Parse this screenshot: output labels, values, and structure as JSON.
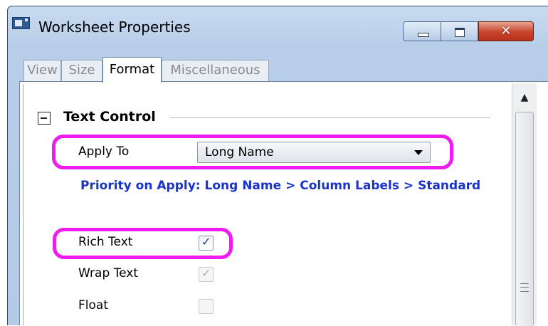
{
  "window": {
    "title": "Worksheet Properties",
    "controls": {
      "minimize_icon": "minimize-icon",
      "maximize_icon": "maximize-icon",
      "close_glyph": "✕"
    }
  },
  "tabs": [
    {
      "label": "View",
      "active": false
    },
    {
      "label": "Size",
      "active": false
    },
    {
      "label": "Format",
      "active": true
    },
    {
      "label": "Miscellaneous",
      "active": false
    }
  ],
  "section": {
    "toggle_icon": "collapse-minus-icon",
    "title": "Text Control"
  },
  "apply_to": {
    "label": "Apply To",
    "value": "Long Name"
  },
  "priority_note": "Priority on Apply: Long Name > Column Labels > Standard",
  "checkboxes": [
    {
      "label": "Rich Text",
      "checked": true,
      "enabled": true
    },
    {
      "label": "Wrap Text",
      "checked": true,
      "enabled": false
    },
    {
      "label": "Float",
      "checked": false,
      "enabled": false
    }
  ],
  "colors": {
    "highlight": "#ee1cee",
    "note_text": "#1a33c9",
    "close_button": "#c7432a"
  },
  "scrollbar": {
    "up_arrow": "▲"
  }
}
